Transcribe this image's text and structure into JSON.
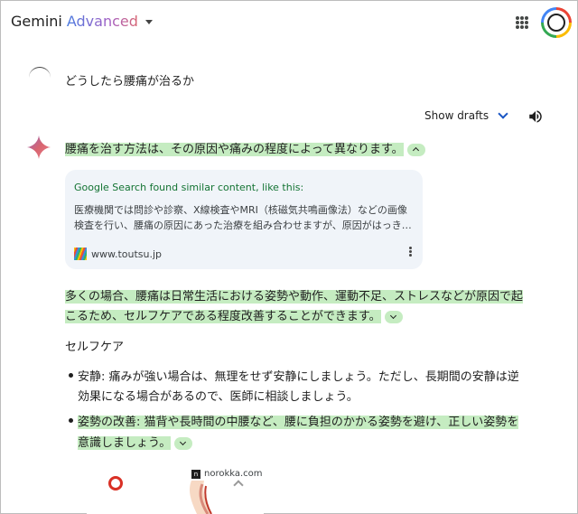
{
  "header": {
    "brand_primary": "Gemini",
    "brand_secondary": "Advanced"
  },
  "prompt": {
    "text": "どうしたら腰痛が治るか"
  },
  "controls": {
    "show_drafts": "Show drafts"
  },
  "response": {
    "intro": "腰痛を治す方法は、その原因や痛みの程度によって異なります。",
    "source_card": {
      "title": "Google Search found similar content, like this:",
      "snippet_line1": "医療機関では問診や診察、X線検査やMRI（核磁気共鳴画像法）などの画像",
      "snippet_line2": "検査を行い、腰痛の原因にあった治療を組み合わせますが、原因がはっき…",
      "site": "www.toutsu.jp"
    },
    "para_line1": "多くの場合、腰痛は日常生活における姿勢や動作、運動不足、ストレスなどが原因で起",
    "para_line2": "こるため、セルフケアである程度改善することができます。",
    "section_heading": "セルフケア",
    "bullets": [
      {
        "line1": "安静: 痛みが強い場合は、無理をせず安静にしましょう。ただし、長期間の安静は逆",
        "line2": "効果になる場合があるので、医師に相談しましょう。"
      },
      {
        "line1": "姿勢の改善: 猫背や長時間の中腰など、腰に負担のかかる姿勢を避け、正しい姿勢を",
        "line2": "意識しましょう。"
      }
    ],
    "image": {
      "source": "norokka.com",
      "logo_text": "n"
    }
  },
  "colors": {
    "highlight": "#c5ecc1",
    "card_bg": "#f0f4f9",
    "card_title": "#137333",
    "accent_blue": "#1a56c4"
  }
}
